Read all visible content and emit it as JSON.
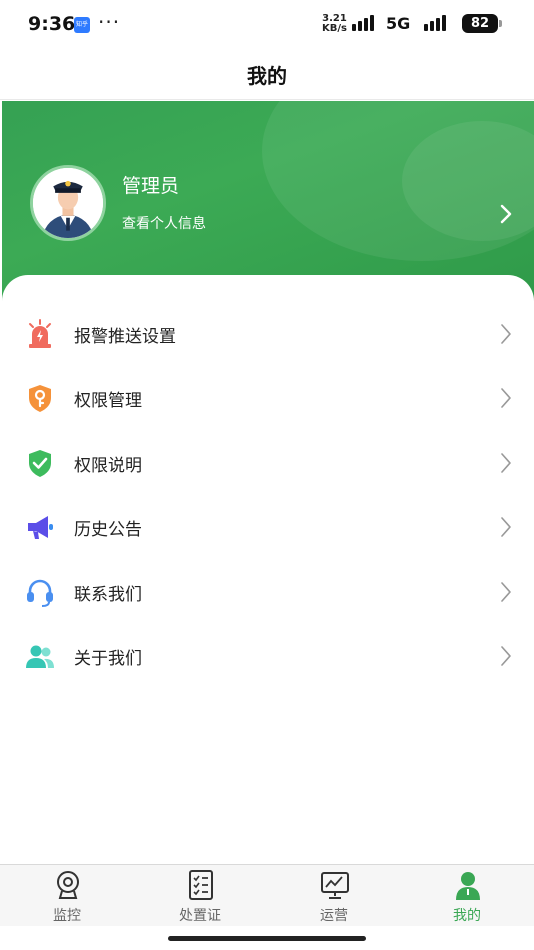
{
  "status_bar": {
    "time": "9:36",
    "app_badge": "知乎",
    "more": "···",
    "speed_value": "3.21",
    "speed_unit": "KB/s",
    "network": "5G",
    "battery": "82"
  },
  "header": {
    "title": "我的"
  },
  "profile": {
    "name": "管理员",
    "link_text": "查看个人信息",
    "avatar_icon": "police-officer-avatar",
    "chevron_icon": "chevron-right-icon"
  },
  "menu": [
    {
      "label": "报警推送设置",
      "icon": "alarm-siren-icon",
      "color": "#f06b5e"
    },
    {
      "label": "权限管理",
      "icon": "shield-key-icon",
      "color": "#f5923a"
    },
    {
      "label": "权限说明",
      "icon": "shield-check-icon",
      "color": "#3dbb5d"
    },
    {
      "label": "历史公告",
      "icon": "megaphone-icon",
      "color": "#5b4ee8"
    },
    {
      "label": "联系我们",
      "icon": "headset-icon",
      "color": "#4a8ff0"
    },
    {
      "label": "关于我们",
      "icon": "users-icon",
      "color": "#36c6b4"
    }
  ],
  "tabs": [
    {
      "label": "监控",
      "icon": "webcam-icon",
      "active": false
    },
    {
      "label": "处置证",
      "icon": "checklist-icon",
      "active": false
    },
    {
      "label": "运营",
      "icon": "chart-board-icon",
      "active": false
    },
    {
      "label": "我的",
      "icon": "person-icon",
      "active": true
    }
  ],
  "colors": {
    "accent": "#3aa754",
    "banner": "#35a153"
  }
}
